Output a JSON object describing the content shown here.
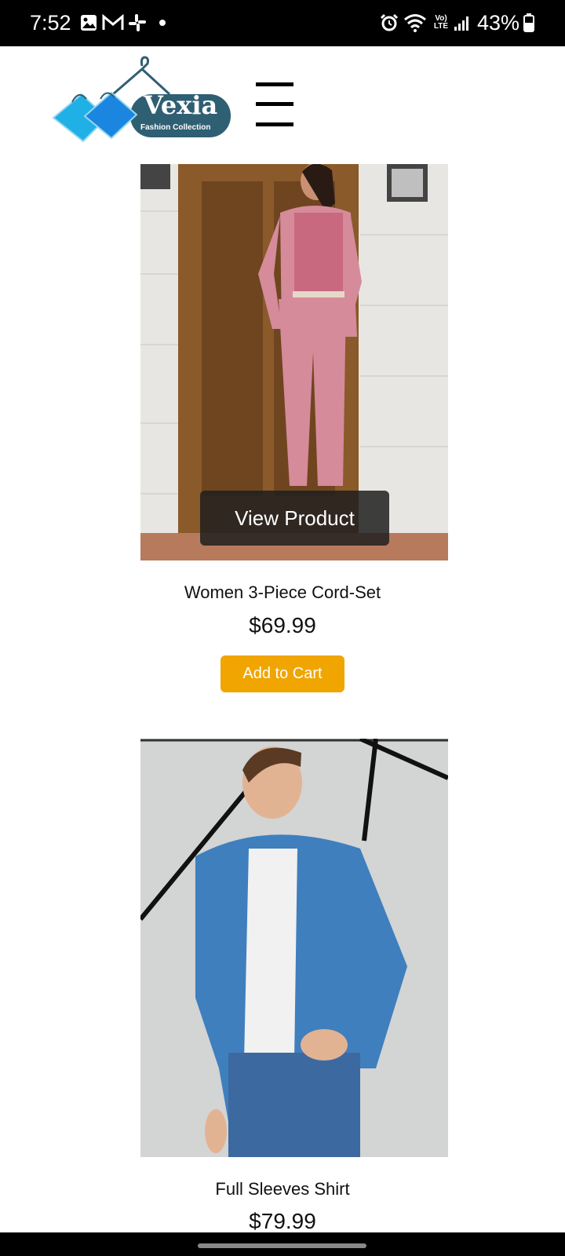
{
  "status_bar": {
    "time": "7:52",
    "battery": "43%",
    "network_label": "Vo) LTE",
    "icons": [
      "gallery-icon",
      "gmail-icon",
      "slack-icon",
      "dot-icon",
      "alarm-icon",
      "wifi-icon",
      "signal-icon",
      "battery-icon"
    ]
  },
  "header": {
    "brand": "Vexia",
    "tagline": "Fashion Collection",
    "menu_icon": "hamburger-menu-icon"
  },
  "products": [
    {
      "name": "Women 3-Piece Cord-Set",
      "price": "$69.99",
      "overlay_label": "View Product",
      "cart_label": "Add to Cart"
    },
    {
      "name": "Full Sleeves Shirt",
      "price": "$79.99"
    }
  ],
  "colors": {
    "accent": "#f0a500",
    "brand": "#2f5f73",
    "overlay": "#1e1e1e"
  }
}
